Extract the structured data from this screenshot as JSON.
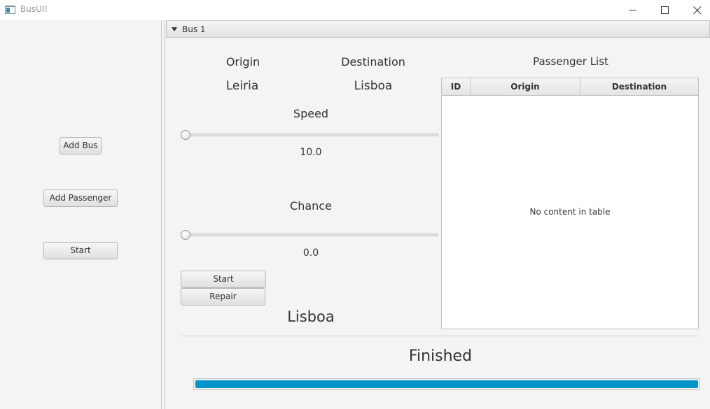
{
  "window": {
    "title": "BusUI!",
    "controls": {
      "minimize": "minimize-icon",
      "maximize": "maximize-icon",
      "close": "close-icon"
    }
  },
  "sidebar": {
    "add_bus": "Add Bus",
    "add_passenger": "Add Passenger",
    "start": "Start"
  },
  "bus_pane": {
    "title": "Bus 1",
    "expanded": true,
    "origin_label": "Origin",
    "origin_value": "Leiria",
    "destination_label": "Destination",
    "destination_value": "Lisboa",
    "speed_label": "Speed",
    "speed_value": "10.0",
    "speed_level": 0,
    "chance_label": "Chance",
    "chance_value": "0.0",
    "chance_level": 0,
    "start_button": "Start",
    "repair_button": "Repair",
    "current_location": "Lisboa",
    "status": "Finished",
    "progress": 1.0
  },
  "passenger_list": {
    "title": "Passenger List",
    "columns": [
      "ID",
      "Origin",
      "Destination"
    ],
    "rows": [],
    "empty_message": "No content in table"
  },
  "colors": {
    "progress_fill": "#0096c9"
  }
}
